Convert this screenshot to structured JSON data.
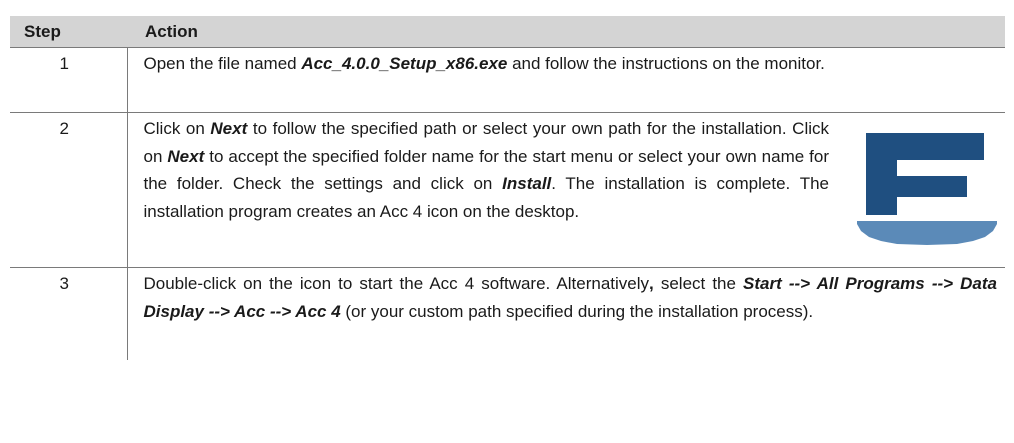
{
  "table": {
    "headers": {
      "step": "Step",
      "action": "Action"
    },
    "rows": [
      {
        "step": "1",
        "text": {
          "t1": "Open the file named ",
          "b1": "Acc_4.0.0_Setup_x86.exe",
          "t2": " and follow the instructions on the monitor."
        }
      },
      {
        "step": "2",
        "text": {
          "t1": "Click on ",
          "b1": "Next",
          "t2": " to follow the specified path or select your own path for the installation. Click on ",
          "b2": "Next",
          "t3": " to accept the specified folder name for the start menu or select your own name for the folder. Check the settings and click on ",
          "b3": "Install",
          "t4": ". The installation is complete. The installation program creates an Acc 4 icon on the desktop."
        },
        "icon": "acc-4-f-logo-icon",
        "icon_colors": {
          "letter": "#1f4f80",
          "base": "#5b8ab8"
        }
      },
      {
        "step": "3",
        "text": {
          "t1": "Double-click on the icon to start the Acc 4 software. Alternatively",
          "t_comma": ",",
          "t2": " select the ",
          "b1": "Start --> All Programs --> Data Display --> Acc --> Acc 4",
          "t3": " (or your custom path specified during the installation process)."
        }
      }
    ]
  }
}
